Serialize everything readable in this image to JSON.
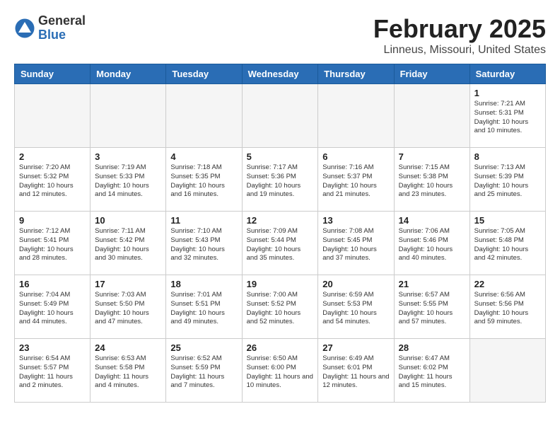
{
  "header": {
    "logo_general": "General",
    "logo_blue": "Blue",
    "month_title": "February 2025",
    "location": "Linneus, Missouri, United States"
  },
  "weekdays": [
    "Sunday",
    "Monday",
    "Tuesday",
    "Wednesday",
    "Thursday",
    "Friday",
    "Saturday"
  ],
  "weeks": [
    [
      {
        "day": "",
        "info": ""
      },
      {
        "day": "",
        "info": ""
      },
      {
        "day": "",
        "info": ""
      },
      {
        "day": "",
        "info": ""
      },
      {
        "day": "",
        "info": ""
      },
      {
        "day": "",
        "info": ""
      },
      {
        "day": "1",
        "info": "Sunrise: 7:21 AM\nSunset: 5:31 PM\nDaylight: 10 hours and 10 minutes."
      }
    ],
    [
      {
        "day": "2",
        "info": "Sunrise: 7:20 AM\nSunset: 5:32 PM\nDaylight: 10 hours and 12 minutes."
      },
      {
        "day": "3",
        "info": "Sunrise: 7:19 AM\nSunset: 5:33 PM\nDaylight: 10 hours and 14 minutes."
      },
      {
        "day": "4",
        "info": "Sunrise: 7:18 AM\nSunset: 5:35 PM\nDaylight: 10 hours and 16 minutes."
      },
      {
        "day": "5",
        "info": "Sunrise: 7:17 AM\nSunset: 5:36 PM\nDaylight: 10 hours and 19 minutes."
      },
      {
        "day": "6",
        "info": "Sunrise: 7:16 AM\nSunset: 5:37 PM\nDaylight: 10 hours and 21 minutes."
      },
      {
        "day": "7",
        "info": "Sunrise: 7:15 AM\nSunset: 5:38 PM\nDaylight: 10 hours and 23 minutes."
      },
      {
        "day": "8",
        "info": "Sunrise: 7:13 AM\nSunset: 5:39 PM\nDaylight: 10 hours and 25 minutes."
      }
    ],
    [
      {
        "day": "9",
        "info": "Sunrise: 7:12 AM\nSunset: 5:41 PM\nDaylight: 10 hours and 28 minutes."
      },
      {
        "day": "10",
        "info": "Sunrise: 7:11 AM\nSunset: 5:42 PM\nDaylight: 10 hours and 30 minutes."
      },
      {
        "day": "11",
        "info": "Sunrise: 7:10 AM\nSunset: 5:43 PM\nDaylight: 10 hours and 32 minutes."
      },
      {
        "day": "12",
        "info": "Sunrise: 7:09 AM\nSunset: 5:44 PM\nDaylight: 10 hours and 35 minutes."
      },
      {
        "day": "13",
        "info": "Sunrise: 7:08 AM\nSunset: 5:45 PM\nDaylight: 10 hours and 37 minutes."
      },
      {
        "day": "14",
        "info": "Sunrise: 7:06 AM\nSunset: 5:46 PM\nDaylight: 10 hours and 40 minutes."
      },
      {
        "day": "15",
        "info": "Sunrise: 7:05 AM\nSunset: 5:48 PM\nDaylight: 10 hours and 42 minutes."
      }
    ],
    [
      {
        "day": "16",
        "info": "Sunrise: 7:04 AM\nSunset: 5:49 PM\nDaylight: 10 hours and 44 minutes."
      },
      {
        "day": "17",
        "info": "Sunrise: 7:03 AM\nSunset: 5:50 PM\nDaylight: 10 hours and 47 minutes."
      },
      {
        "day": "18",
        "info": "Sunrise: 7:01 AM\nSunset: 5:51 PM\nDaylight: 10 hours and 49 minutes."
      },
      {
        "day": "19",
        "info": "Sunrise: 7:00 AM\nSunset: 5:52 PM\nDaylight: 10 hours and 52 minutes."
      },
      {
        "day": "20",
        "info": "Sunrise: 6:59 AM\nSunset: 5:53 PM\nDaylight: 10 hours and 54 minutes."
      },
      {
        "day": "21",
        "info": "Sunrise: 6:57 AM\nSunset: 5:55 PM\nDaylight: 10 hours and 57 minutes."
      },
      {
        "day": "22",
        "info": "Sunrise: 6:56 AM\nSunset: 5:56 PM\nDaylight: 10 hours and 59 minutes."
      }
    ],
    [
      {
        "day": "23",
        "info": "Sunrise: 6:54 AM\nSunset: 5:57 PM\nDaylight: 11 hours and 2 minutes."
      },
      {
        "day": "24",
        "info": "Sunrise: 6:53 AM\nSunset: 5:58 PM\nDaylight: 11 hours and 4 minutes."
      },
      {
        "day": "25",
        "info": "Sunrise: 6:52 AM\nSunset: 5:59 PM\nDaylight: 11 hours and 7 minutes."
      },
      {
        "day": "26",
        "info": "Sunrise: 6:50 AM\nSunset: 6:00 PM\nDaylight: 11 hours and 10 minutes."
      },
      {
        "day": "27",
        "info": "Sunrise: 6:49 AM\nSunset: 6:01 PM\nDaylight: 11 hours and 12 minutes."
      },
      {
        "day": "28",
        "info": "Sunrise: 6:47 AM\nSunset: 6:02 PM\nDaylight: 11 hours and 15 minutes."
      },
      {
        "day": "",
        "info": ""
      }
    ]
  ]
}
